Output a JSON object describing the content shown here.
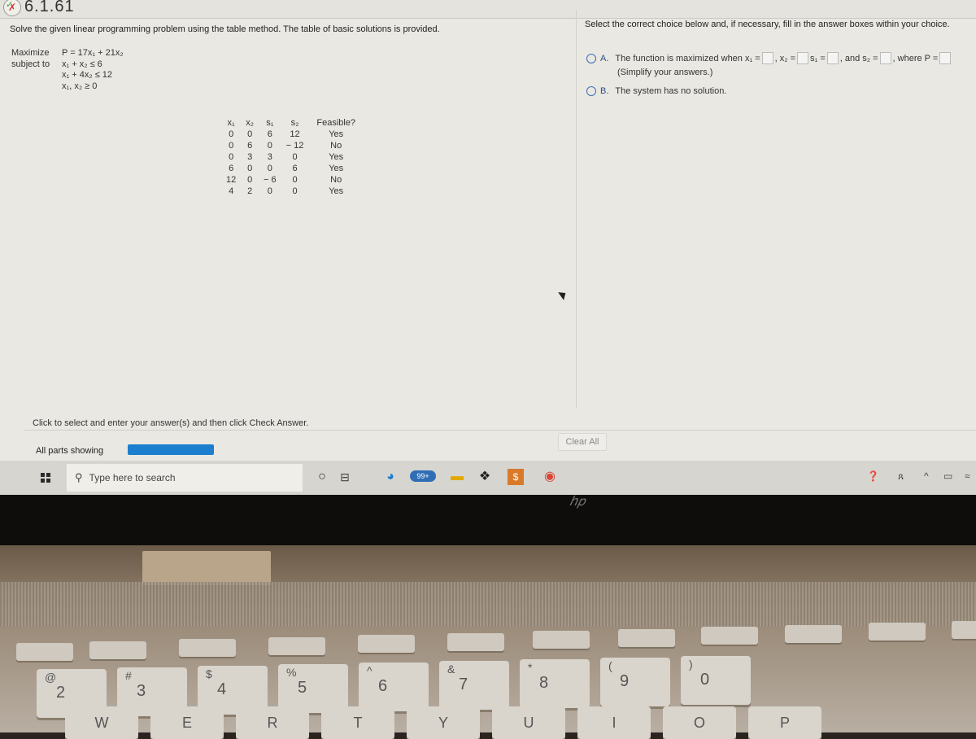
{
  "question_id": "6.1.61",
  "instruction": "Solve the given linear programming problem using the table method. The table of basic solutions is provided.",
  "problem": {
    "objective_label": "Maximize",
    "objective": "P = 17x₁ + 21x₂",
    "constraints_label": "subject to",
    "constraints": [
      "x₁ + x₂ ≤ 6",
      "x₁ + 4x₂ ≤ 12",
      "x₁, x₂ ≥ 0"
    ]
  },
  "table": {
    "headers": [
      "x₁",
      "x₂",
      "s₁",
      "s₂",
      "Feasible?"
    ],
    "rows": [
      [
        "0",
        "0",
        "6",
        "12",
        "Yes"
      ],
      [
        "0",
        "6",
        "0",
        "− 12",
        "No"
      ],
      [
        "0",
        "3",
        "3",
        "0",
        "Yes"
      ],
      [
        "6",
        "0",
        "0",
        "6",
        "Yes"
      ],
      [
        "12",
        "0",
        "− 6",
        "0",
        "No"
      ],
      [
        "4",
        "2",
        "0",
        "0",
        "Yes"
      ]
    ]
  },
  "answer_panel": {
    "instruction": "Select the correct choice below and, if necessary, fill in the answer boxes within your choice.",
    "option_a": {
      "letter": "A.",
      "text_1": "The function is maximized when x₁ =",
      "text_2": ", x₂ =",
      "text_3": "s₁ =",
      "text_4": ", and s₂ =",
      "text_5": ", where P =",
      "hint": "(Simplify your answers.)",
      "values": {
        "x1": "",
        "x2": "",
        "s1": "",
        "s2": "",
        "P": ""
      }
    },
    "option_b": {
      "letter": "B.",
      "text": "The system has no solution."
    }
  },
  "footer": {
    "click_message": "Click to select and enter your answer(s) and then click Check Answer.",
    "all_parts_label": "All parts showing",
    "progress_fraction": 1.0,
    "clear_all_label": "Clear All"
  },
  "taskbar": {
    "search_placeholder": "Type here to search",
    "mail_badge": "99+",
    "colors": {
      "progress": "#1c7ecf",
      "radio": "#3b6fb5"
    }
  },
  "keyboard": {
    "number_row": [
      {
        "shift": "@",
        "main": "2"
      },
      {
        "shift": "#",
        "main": "3"
      },
      {
        "shift": "$",
        "main": "4"
      },
      {
        "shift": "%",
        "main": "5"
      },
      {
        "shift": "^",
        "main": "6"
      },
      {
        "shift": "&",
        "main": "7"
      },
      {
        "shift": "*",
        "main": "8"
      },
      {
        "shift": "(",
        "main": "9"
      },
      {
        "shift": ")",
        "main": "0"
      }
    ],
    "letter_row": [
      "W",
      "E",
      "R",
      "T",
      "Y",
      "U",
      "I",
      "O",
      "P"
    ]
  }
}
